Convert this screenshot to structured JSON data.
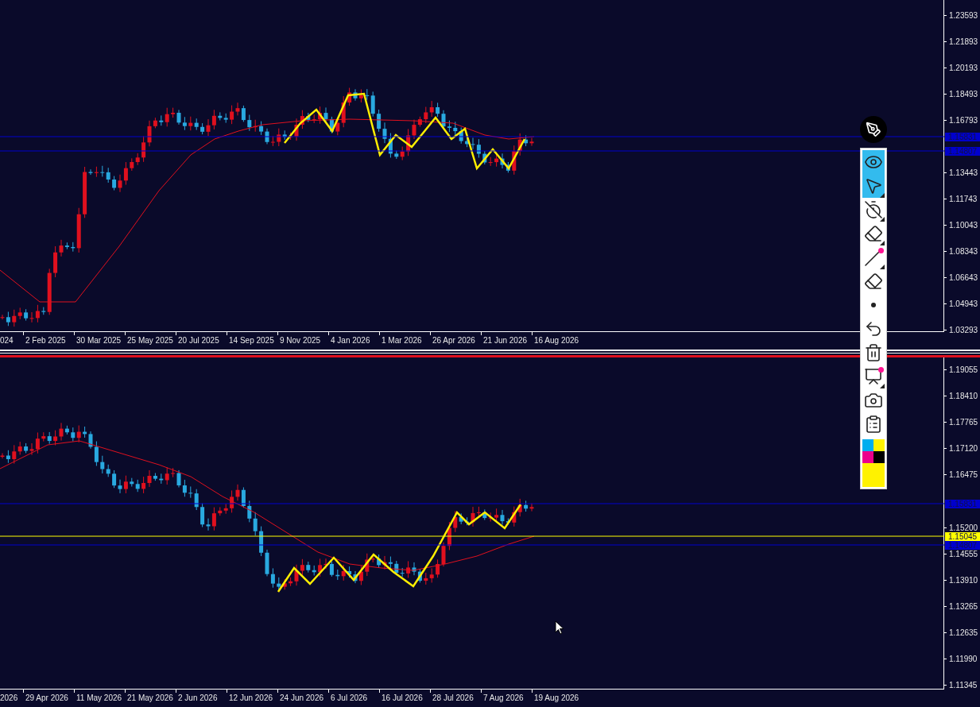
{
  "top_pane": {
    "price_ticks": [
      "1.23593",
      "1.21893",
      "1.20193",
      "1.18493",
      "1.16793",
      "1.13443",
      "1.11743",
      "1.10043",
      "1.08343",
      "1.06643",
      "1.04943",
      "1.03293"
    ],
    "price_labels": [
      {
        "text": "1.15831",
        "color": "#0000cc"
      },
      {
        "text": "1.14807",
        "color": "#0000cc"
      }
    ],
    "date_ticks": [
      "024",
      "2 Feb 2025",
      "30 Mar 2025",
      "25 May 2025",
      "20 Jul 2025",
      "14 Sep 2025",
      "9 Nov 2025",
      "4 Jan 2026",
      "1 Mar 2026",
      "26 Apr 2026",
      "21 Jun 2026",
      "16 Aug 2026"
    ]
  },
  "bottom_pane": {
    "price_ticks": [
      "1.19055",
      "1.18410",
      "1.17765",
      "1.17120",
      "1.16475",
      "1.15200",
      "1.14555",
      "1.13910",
      "1.13265",
      "1.12635",
      "1.11990",
      "1.11345"
    ],
    "price_labels": [
      {
        "text": "1.15831",
        "color": "#0000cc"
      },
      {
        "text": "1.15045",
        "color": "#ffff00"
      },
      {
        "text": "1.14807",
        "color": "#0000cc"
      }
    ],
    "date_ticks": [
      "2026",
      "29 Apr 2026",
      "11 May 2026",
      "21 May 2026",
      "2 Jun 2026",
      "12 Jun 2026",
      "24 Jun 2026",
      "6 Jul 2026",
      "16 Jul 2026",
      "28 Jul 2026",
      "7 Aug 2026",
      "19 Aug 2026"
    ]
  },
  "toolbar": {
    "tools": [
      {
        "kind": "eye",
        "selected": true,
        "badge": false,
        "submenu": false
      },
      {
        "kind": "pointer",
        "selected": true,
        "badge": false,
        "submenu": true
      },
      {
        "kind": "timer",
        "selected": false,
        "badge": false,
        "submenu": true
      },
      {
        "kind": "eraser",
        "selected": false,
        "badge": false,
        "submenu": true
      },
      {
        "kind": "line",
        "selected": false,
        "badge": true,
        "submenu": true
      },
      {
        "kind": "rubber",
        "selected": false,
        "badge": false,
        "submenu": false
      },
      {
        "kind": "dot",
        "selected": false,
        "badge": false,
        "submenu": false
      },
      {
        "kind": "undo",
        "selected": false,
        "badge": false,
        "submenu": false
      },
      {
        "kind": "trash",
        "selected": false,
        "badge": false,
        "submenu": false
      },
      {
        "kind": "easel",
        "selected": false,
        "badge": true,
        "submenu": true
      },
      {
        "kind": "camera",
        "selected": false,
        "badge": false,
        "submenu": false
      },
      {
        "kind": "clipboard",
        "selected": false,
        "badge": false,
        "submenu": false
      }
    ],
    "palette": [
      {
        "kind": "small",
        "color": "#00aeef"
      },
      {
        "kind": "small",
        "color": "#fff200"
      },
      {
        "kind": "small",
        "color": "#ec008c"
      },
      {
        "kind": "small",
        "color": "#000000"
      },
      {
        "kind": "wide",
        "color": "#fff200"
      }
    ]
  }
}
